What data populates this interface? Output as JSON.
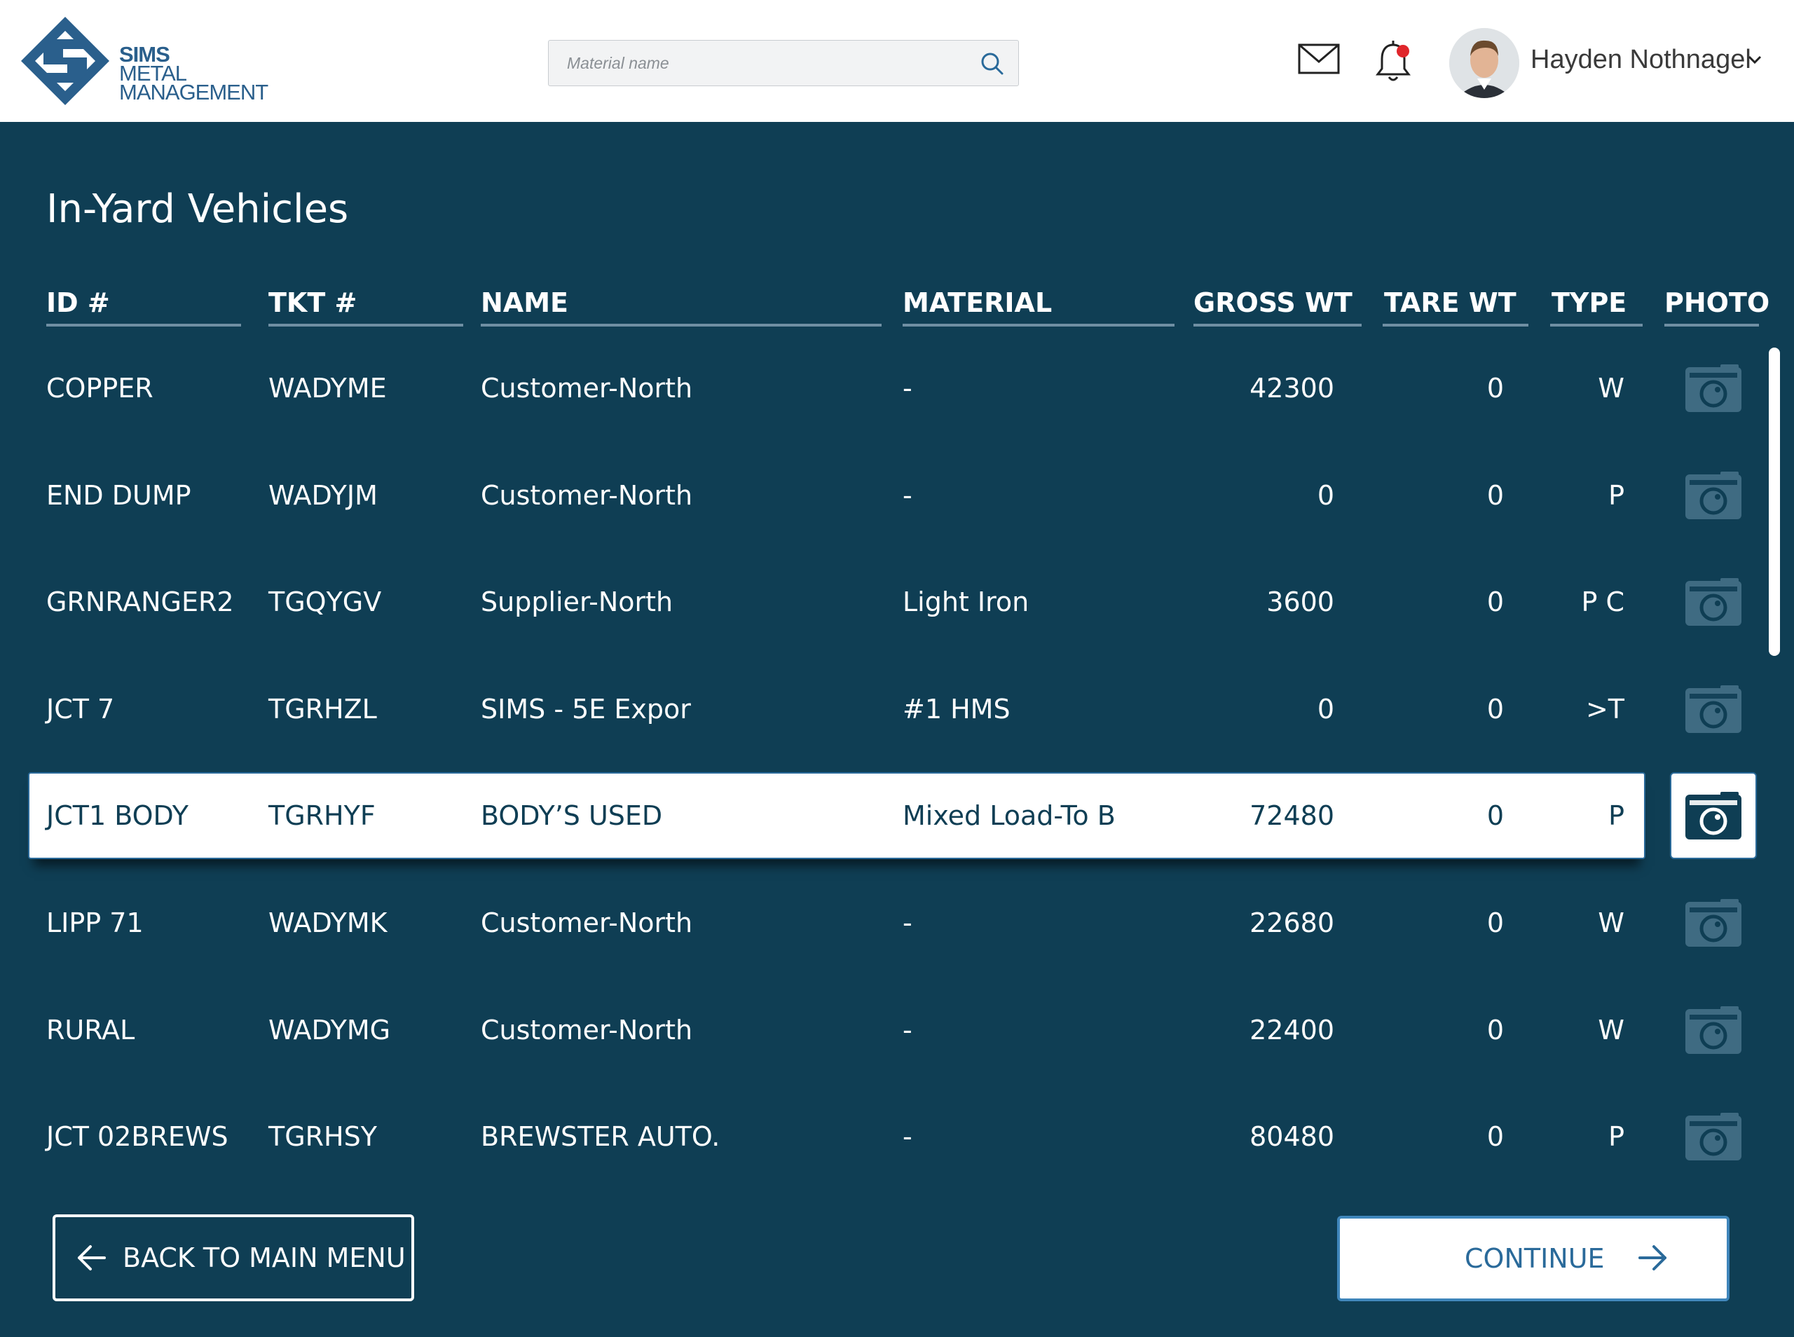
{
  "brand": {
    "logo_lines": [
      "SIMS",
      "METAL",
      "MANAGEMENT"
    ],
    "brand_color": "#2a5f8c"
  },
  "header": {
    "search_placeholder": "Material name",
    "user_name": "Hayden Nothnagel",
    "notification_dot_color": "#e0262b"
  },
  "page": {
    "title": "In-Yard Vehicles"
  },
  "table": {
    "columns": [
      "ID #",
      "TKT #",
      "NAME",
      "MATERIAL",
      "GROSS WT",
      "TARE WT",
      "TYPE",
      "PHOTO"
    ],
    "rows": [
      {
        "id": "COPPER",
        "tkt": "WADYME",
        "name": "Customer-North",
        "material": "-",
        "gross": "42300",
        "tare": "0",
        "type": "W"
      },
      {
        "id": "END DUMP",
        "tkt": "WADYJM",
        "name": "Customer-North",
        "material": "-",
        "gross": "0",
        "tare": "0",
        "type": "P"
      },
      {
        "id": "GRNRANGER2",
        "tkt": "TGQYGV",
        "name": "Supplier-North",
        "material": "Light Iron",
        "gross": "3600",
        "tare": "0",
        "type": "P C"
      },
      {
        "id": "JCT 7",
        "tkt": "TGRHZL",
        "name": "SIMS - 5E Expor",
        "material": "#1 HMS",
        "gross": "0",
        "tare": "0",
        "type": ">T"
      },
      {
        "id": "JCT1 BODY",
        "tkt": "TGRHYF",
        "name": "BODY’S USED",
        "material": "Mixed Load-To B",
        "gross": "72480",
        "tare": "0",
        "type": "P",
        "selected": true
      },
      {
        "id": "LIPP 71",
        "tkt": "WADYMK",
        "name": "Customer-North",
        "material": "-",
        "gross": "22680",
        "tare": "0",
        "type": "W"
      },
      {
        "id": "RURAL",
        "tkt": "WADYMG",
        "name": "Customer-North",
        "material": "-",
        "gross": "22400",
        "tare": "0",
        "type": "W"
      },
      {
        "id": "JCT 02BREWS",
        "tkt": "TGRHSY",
        "name": "BREWSTER AUTO.",
        "material": "-",
        "gross": "80480",
        "tare": "0",
        "type": "P"
      }
    ]
  },
  "actions": {
    "back_label": "BACK TO MAIN MENU",
    "continue_label": "CONTINUE"
  },
  "colors": {
    "background": "#0f3e54",
    "accent": "#3f86bb",
    "photo_icon_inactive": "#3f6b82"
  }
}
